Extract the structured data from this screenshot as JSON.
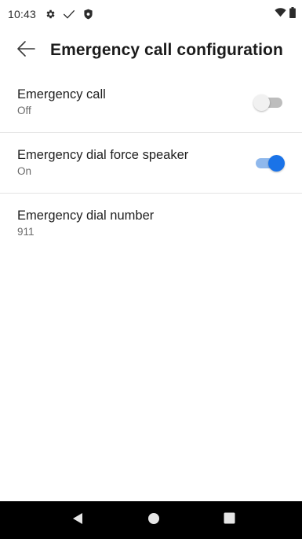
{
  "status_bar": {
    "time": "10:43",
    "icons_left": [
      "gear-icon",
      "check-icon",
      "shield-icon"
    ],
    "icons_right": [
      "wifi-icon",
      "battery-icon"
    ]
  },
  "app_bar": {
    "title": "Emergency call configuration",
    "back_icon": "arrow-left-icon"
  },
  "settings": [
    {
      "title": "Emergency call",
      "summary": "Off",
      "toggle": "off"
    },
    {
      "title": "Emergency dial force speaker",
      "summary": "On",
      "toggle": "on"
    },
    {
      "title": "Emergency dial number",
      "summary": "911",
      "toggle": null
    }
  ],
  "nav_bar": {
    "buttons": [
      "back-triangle-icon",
      "home-circle-icon",
      "recents-square-icon"
    ]
  },
  "colors": {
    "accent": "#1a73e8",
    "accent_track": "#8fb8ec",
    "toggle_off_track": "#bdbdbd",
    "toggle_off_thumb": "#f1f1f1",
    "nav_background": "#000000"
  }
}
